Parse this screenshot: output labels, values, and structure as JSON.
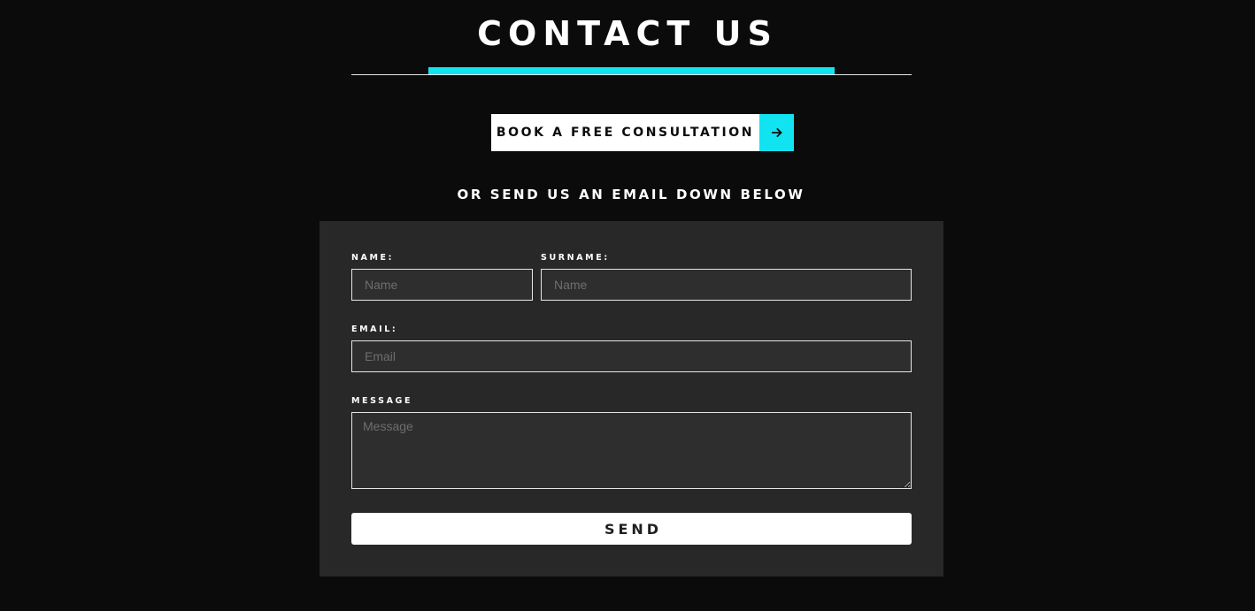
{
  "header": {
    "title": "CONTACT US"
  },
  "cta": {
    "label": "BOOK A FREE CONSULTATION",
    "icon": "arrow-right-icon"
  },
  "subheading": "OR SEND US AN EMAIL DOWN BELOW",
  "form": {
    "name": {
      "label": "NAME:",
      "placeholder": "Name",
      "value": ""
    },
    "surname": {
      "label": "SURNAME:",
      "placeholder": "Name",
      "value": ""
    },
    "email": {
      "label": "EMAIL:",
      "placeholder": "Email",
      "value": ""
    },
    "message": {
      "label": "MESSAGE",
      "placeholder": "Message",
      "value": ""
    },
    "submit_label": "SEND"
  },
  "colors": {
    "background": "#0b0b0b",
    "panel": "#282828",
    "accent": "#12e3f0",
    "text": "#ffffff"
  }
}
